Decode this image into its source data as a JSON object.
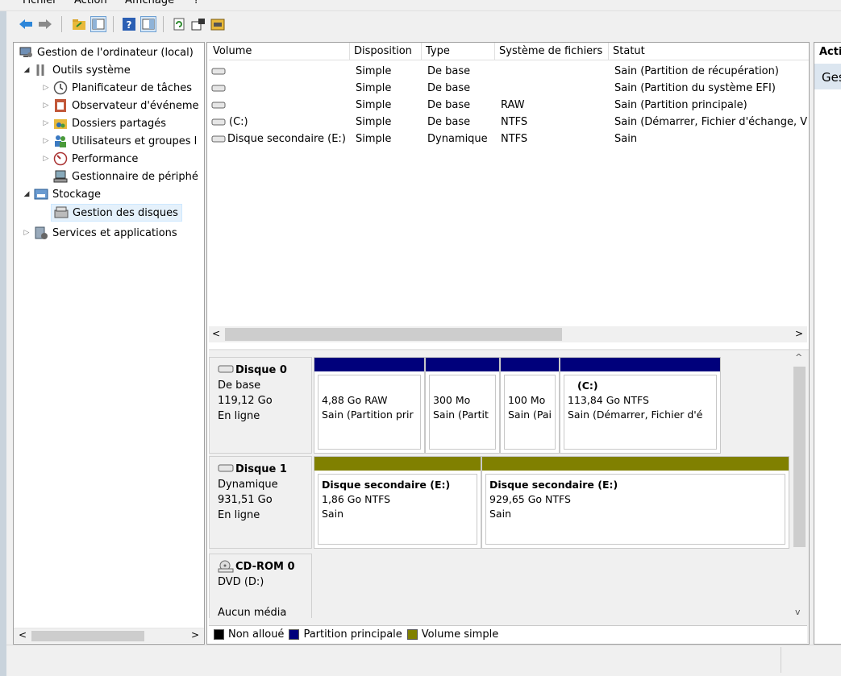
{
  "menu": {
    "items": [
      "Fichier",
      "Action",
      "Affichage",
      "?"
    ]
  },
  "toolbar": {
    "buttons": [
      "back-icon",
      "forward-icon",
      "up-folder-icon",
      "show-hide-tree-icon",
      "help-icon",
      "show-action-pane-icon",
      "refresh-icon",
      "properties-icon",
      "rescan-disks-icon"
    ]
  },
  "tree": {
    "root": "Gestion de l'ordinateur (local)",
    "system_tools": "Outils système",
    "task_scheduler": "Planificateur de tâches",
    "event_viewer": "Observateur d'événeme",
    "shared_folders": "Dossiers partagés",
    "users_groups": "Utilisateurs et groupes l",
    "performance": "Performance",
    "device_manager": "Gestionnaire de périphé",
    "storage": "Stockage",
    "disk_management": "Gestion des disques",
    "services_apps": "Services et applications"
  },
  "volumes": {
    "headers": [
      "Volume",
      "Disposition",
      "Type",
      "Système de fichiers",
      "Statut"
    ],
    "rows": [
      {
        "volume": "",
        "disposition": "Simple",
        "type": "De base",
        "fs": "",
        "status": "Sain (Partition de récupération)"
      },
      {
        "volume": "",
        "disposition": "Simple",
        "type": "De base",
        "fs": "",
        "status": "Sain (Partition du système EFI)"
      },
      {
        "volume": "",
        "disposition": "Simple",
        "type": "De base",
        "fs": "RAW",
        "status": "Sain (Partition principale)"
      },
      {
        "volume": "(C:)",
        "disposition": "Simple",
        "type": "De base",
        "fs": "NTFS",
        "status": "Sain (Démarrer, Fichier d'échange, V"
      },
      {
        "volume": "Disque secondaire (E:)",
        "disposition": "Simple",
        "type": "Dynamique",
        "fs": "NTFS",
        "status": "Sain"
      }
    ]
  },
  "disks": {
    "disk0": {
      "name": "Disque 0",
      "kind": "De base",
      "size": "119,12 Go",
      "state": "En ligne",
      "partitions": [
        {
          "title": "",
          "size": "4,88 Go RAW",
          "status": "Sain (Partition prir"
        },
        {
          "title": "",
          "size": "300 Mo",
          "status": "Sain (Partit"
        },
        {
          "title": "",
          "size": "100 Mo",
          "status": "Sain (Pai"
        },
        {
          "title": "(C:)",
          "size": "113,84 Go NTFS",
          "status": "Sain (Démarrer, Fichier d'é"
        }
      ]
    },
    "disk1": {
      "name": "Disque 1",
      "kind": "Dynamique",
      "size": "931,51 Go",
      "state": "En ligne",
      "partitions": [
        {
          "title": "Disque secondaire  (E:)",
          "size": "1,86 Go NTFS",
          "status": "Sain"
        },
        {
          "title": "Disque secondaire  (E:)",
          "size": "929,65 Go NTFS",
          "status": "Sain"
        }
      ]
    },
    "cdrom": {
      "name": "CD-ROM 0",
      "kind": "DVD (D:)",
      "state": "Aucun média"
    }
  },
  "legend": {
    "unallocated": "Non alloué",
    "primary": "Partition principale",
    "simple": "Volume simple"
  },
  "actions": {
    "header": "Acti",
    "item": "Ges"
  },
  "colors": {
    "primary": "#00007b",
    "simple": "#808000",
    "unallocated": "#000000",
    "selection": "#e5f1fb"
  }
}
